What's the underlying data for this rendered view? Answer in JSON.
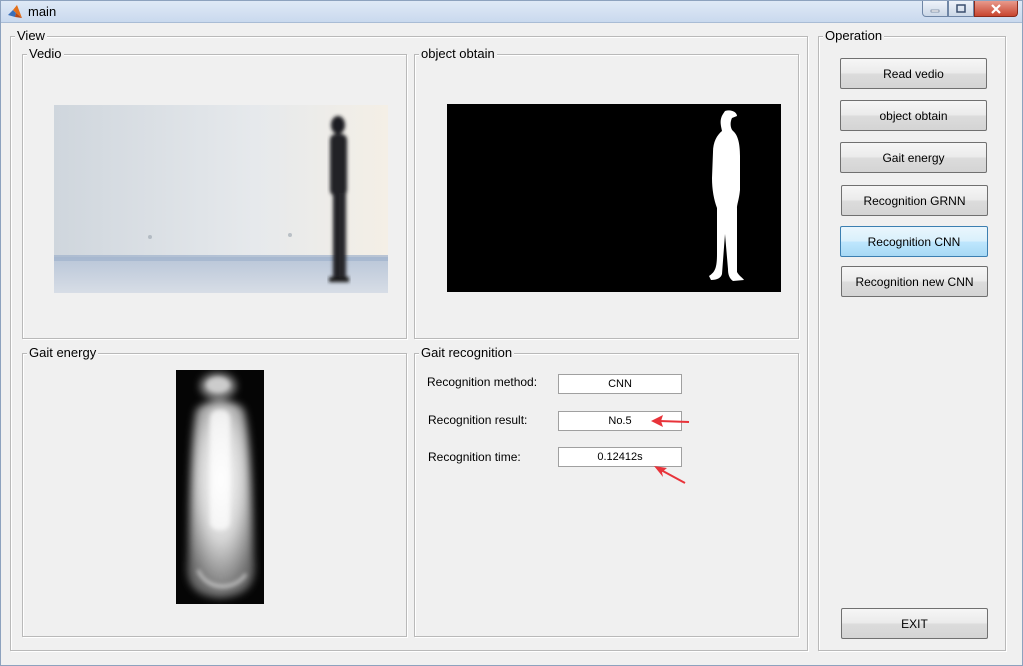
{
  "window": {
    "title": "main"
  },
  "view": {
    "title": "View",
    "vedio_panel": {
      "title": "Vedio"
    },
    "object_panel": {
      "title": "object obtain"
    },
    "gait_energy_panel": {
      "title": "Gait energy"
    },
    "recognition_panel": {
      "title": "Gait recognition",
      "method_label": "Recognition method:",
      "method_value": "CNN",
      "result_label": "Recognition result:",
      "result_value": "No.5",
      "time_label": "Recognition time:",
      "time_value": "0.12412s"
    }
  },
  "operation": {
    "title": "Operation",
    "buttons": [
      "Read vedio",
      "object obtain",
      "Gait energy",
      "Recognition GRNN",
      "Recognition CNN",
      "Recognition new CNN"
    ],
    "exit_label": "EXIT"
  },
  "colors": {
    "annotation_arrow": "#e8333a",
    "active_button": "#bee6fd"
  }
}
